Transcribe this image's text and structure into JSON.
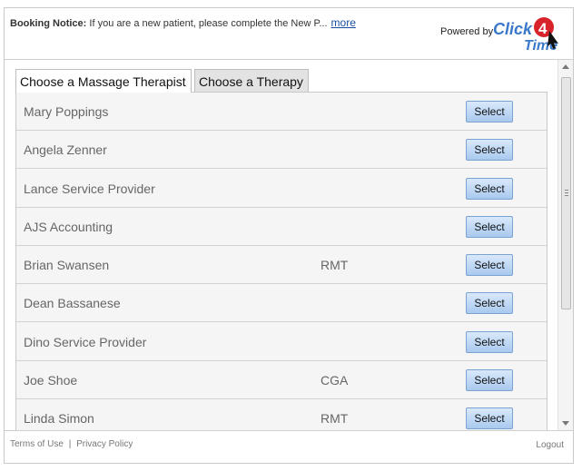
{
  "notice": {
    "label": "Booking Notice:",
    "text": "If you are a new patient, please complete the New P...",
    "more_link": "more"
  },
  "branding": {
    "powered_by": "Powered by",
    "logo_text_1": "Click",
    "logo_text_2": "4",
    "logo_text_3": "Time"
  },
  "tabs": [
    {
      "label": "Choose a Massage Therapist",
      "active": true
    },
    {
      "label": "Choose a Therapy",
      "active": false
    }
  ],
  "providers": [
    {
      "name": "Mary Poppings",
      "credential": "",
      "button": "Select"
    },
    {
      "name": "Angela Zenner",
      "credential": "",
      "button": "Select"
    },
    {
      "name": "Lance Service Provider",
      "credential": "",
      "button": "Select"
    },
    {
      "name": "AJS Accounting",
      "credential": "",
      "button": "Select"
    },
    {
      "name": "Brian Swansen",
      "credential": "RMT",
      "button": "Select"
    },
    {
      "name": "Dean Bassanese",
      "credential": "",
      "button": "Select"
    },
    {
      "name": "Dino Service Provider",
      "credential": "",
      "button": "Select"
    },
    {
      "name": "Joe Shoe",
      "credential": "CGA",
      "button": "Select"
    },
    {
      "name": "Linda Simon",
      "credential": "RMT",
      "button": "Select"
    }
  ],
  "footer": {
    "terms": "Terms of Use",
    "separator": "|",
    "privacy": "Privacy Policy",
    "logout": "Logout"
  },
  "colors": {
    "link": "#1a4fa3",
    "button_top": "#d9e9fb",
    "button_bottom": "#a9c9ee",
    "logo_red": "#d8232a",
    "logo_blue": "#3a78c9"
  }
}
